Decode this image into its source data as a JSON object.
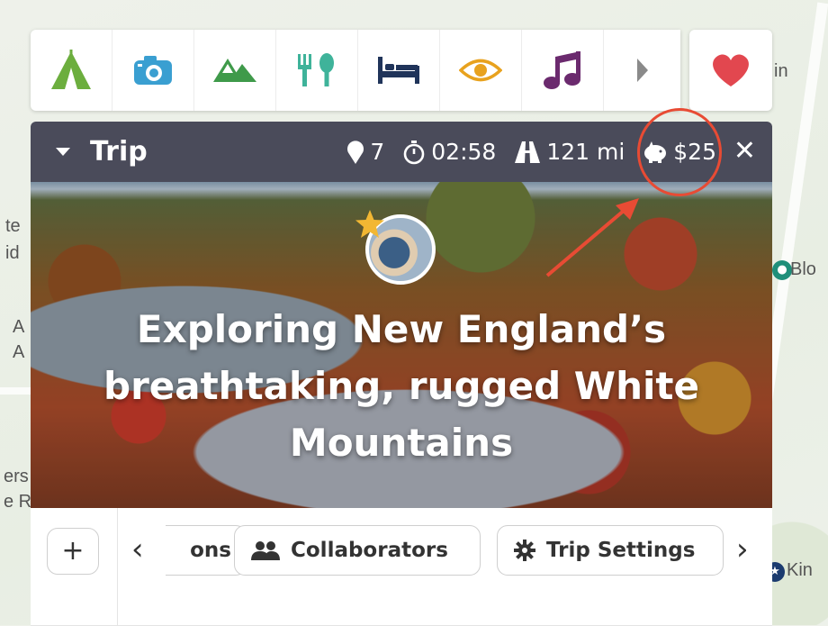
{
  "map": {
    "labels": [
      "in",
      "te",
      "id",
      "Blo",
      "A",
      "A",
      "ers",
      "e R",
      "Kin"
    ]
  },
  "toolbar": {
    "icons": [
      "tent-icon",
      "camera-icon",
      "mountain-icon",
      "food-icon",
      "bed-icon",
      "eye-icon",
      "music-icon",
      "chevron-right-icon"
    ],
    "favorite_icon": "heart-icon"
  },
  "trip": {
    "title": "Trip",
    "stops": "7",
    "duration": "02:58",
    "distance": "121 mi",
    "cost": "$25"
  },
  "hero": {
    "title": "Exploring New England’s breathtaking, rugged White Mountains"
  },
  "actions": {
    "add_label": "+",
    "truncated_label": "ons",
    "collaborators_label": "Collaborators",
    "settings_label": "Trip Settings",
    "prev_label": "‹",
    "next_label": "›"
  },
  "colors": {
    "header_bg": "#4a4b5a",
    "annotation": "#e84b34",
    "tent": "#6cae3e",
    "camera": "#3a9fd1",
    "mountain": "#3f9a4a",
    "food": "#3fb39a",
    "bed": "#20345a",
    "eye": "#e8a21e",
    "music": "#6b2a6e",
    "heart": "#e2474f"
  }
}
